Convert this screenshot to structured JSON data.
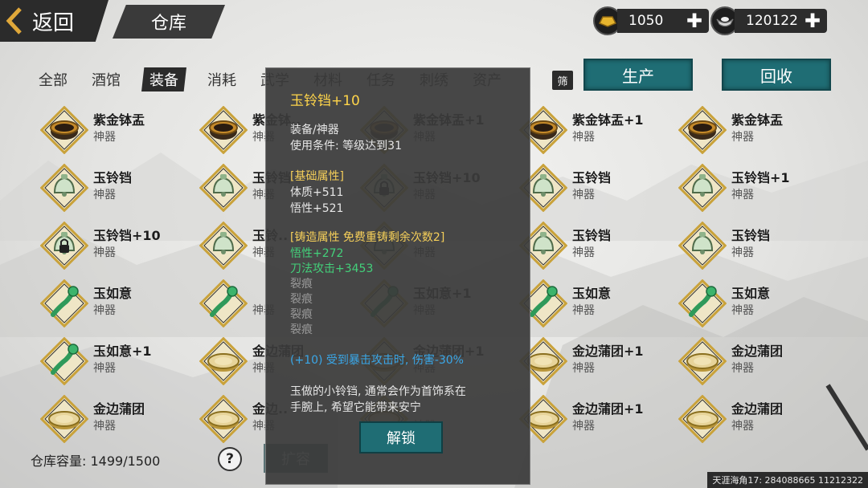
{
  "header": {
    "back_label": "返回",
    "title": "仓库",
    "currencies": [
      {
        "icon": "gold-ingot-icon",
        "amount": "1050"
      },
      {
        "icon": "silver-ingot-icon",
        "amount": "120122"
      }
    ]
  },
  "tabs": [
    "全部",
    "酒馆",
    "装备",
    "消耗",
    "武学",
    "材料",
    "任务",
    "刺绣",
    "资产"
  ],
  "active_tab": "装备",
  "filter_label": "筛",
  "actions": {
    "produce": "生产",
    "recycle": "回收"
  },
  "items": [
    [
      {
        "name": "紫金钵盂",
        "type": "神器",
        "icon": "bowl-icon",
        "locked": false
      },
      {
        "name": "紫金钵..",
        "type": "神器",
        "icon": "bowl-icon",
        "locked": false
      },
      {
        "name": "紫金钵盂+1",
        "type": "神器",
        "icon": "bowl-icon",
        "locked": false
      },
      {
        "name": "紫金钵盂+1",
        "type": "神器",
        "icon": "bowl-icon",
        "locked": false
      },
      {
        "name": "紫金钵盂",
        "type": "神器",
        "icon": "bowl-icon",
        "locked": false
      }
    ],
    [
      {
        "name": "玉铃铛",
        "type": "神器",
        "icon": "jade-bell-icon",
        "locked": false
      },
      {
        "name": "玉铃铛",
        "type": "神器",
        "icon": "jade-bell-icon",
        "locked": false
      },
      {
        "name": "玉铃铛+10",
        "type": "神器",
        "icon": "jade-bell-icon",
        "locked": true
      },
      {
        "name": "玉铃铛",
        "type": "神器",
        "icon": "jade-bell-icon",
        "locked": false
      },
      {
        "name": "玉铃铛+1",
        "type": "神器",
        "icon": "jade-bell-icon",
        "locked": false
      }
    ],
    [
      {
        "name": "玉铃铛+10",
        "type": "神器",
        "icon": "jade-bell-icon",
        "locked": true
      },
      {
        "name": "玉铃..",
        "type": "神器",
        "icon": "jade-bell-icon",
        "locked": false
      },
      {
        "name": "",
        "type": "神器",
        "icon": "jade-bell-icon",
        "locked": false
      },
      {
        "name": "玉铃铛",
        "type": "神器",
        "icon": "jade-bell-icon",
        "locked": false
      },
      {
        "name": "玉铃铛",
        "type": "神器",
        "icon": "jade-bell-icon",
        "locked": false
      }
    ],
    [
      {
        "name": "玉如意",
        "type": "神器",
        "icon": "jade-ruyi-icon",
        "locked": false
      },
      {
        "name": "",
        "type": "神器",
        "icon": "jade-ruyi-icon",
        "locked": false
      },
      {
        "name": "玉如意+1",
        "type": "神器",
        "icon": "jade-ruyi-icon",
        "locked": false
      },
      {
        "name": "玉如意",
        "type": "神器",
        "icon": "jade-ruyi-icon",
        "locked": false
      },
      {
        "name": "玉如意",
        "type": "神器",
        "icon": "jade-ruyi-icon",
        "locked": false
      }
    ],
    [
      {
        "name": "玉如意+1",
        "type": "神器",
        "icon": "jade-ruyi-icon",
        "locked": false
      },
      {
        "name": "金边蒲团",
        "type": "神器",
        "icon": "cushion-icon",
        "locked": false
      },
      {
        "name": "金边蒲团+1",
        "type": "神器",
        "icon": "cushion-icon",
        "locked": false
      },
      {
        "name": "金边蒲团+1",
        "type": "神器",
        "icon": "cushion-icon",
        "locked": false
      },
      {
        "name": "金边蒲团",
        "type": "神器",
        "icon": "cushion-icon",
        "locked": false
      }
    ],
    [
      {
        "name": "金边蒲团",
        "type": "神器",
        "icon": "cushion-icon",
        "locked": false
      },
      {
        "name": "金边..",
        "type": "神器",
        "icon": "cushion-icon",
        "locked": false
      },
      {
        "name": "",
        "type": "神器",
        "icon": "cushion-icon",
        "locked": false
      },
      {
        "name": "金边蒲团+1",
        "type": "神器",
        "icon": "cushion-icon",
        "locked": false
      },
      {
        "name": "金边蒲团",
        "type": "神器",
        "icon": "cushion-icon",
        "locked": false
      }
    ]
  ],
  "capacity": {
    "label": "仓库容量:",
    "value": "1499/1500"
  },
  "help_label": "?",
  "expand_label": "扩容",
  "footer_id": "天涯海角17: 284088665 11212322",
  "tooltip": {
    "title": "玉铃铛+10",
    "category": "装备/神器",
    "requirement": "使用条件:  等级达到31",
    "base_header": "[基础属性]",
    "base_stats": [
      "体质+511",
      "悟性+521"
    ],
    "forge_header": "[铸造属性  免费重铸剩余次数2]",
    "forge_stats": [
      "悟性+272",
      "刀法攻击+3453"
    ],
    "cracks": [
      "裂痕",
      "裂痕",
      "裂痕",
      "裂痕"
    ],
    "bonus": "(+10) 受到暴击攻击时, 伤害-30%",
    "description_lines": [
      "玉做的小铃铛, 通常会作为首饰系在",
      "手腕上, 希望它能带来安宁"
    ],
    "unlock_label": "解锁"
  },
  "colors": {
    "teal_button": "#1f6d74",
    "gold_text": "#f5cf5a",
    "green_text": "#43d07a",
    "blue_text": "#3aa7e8"
  }
}
